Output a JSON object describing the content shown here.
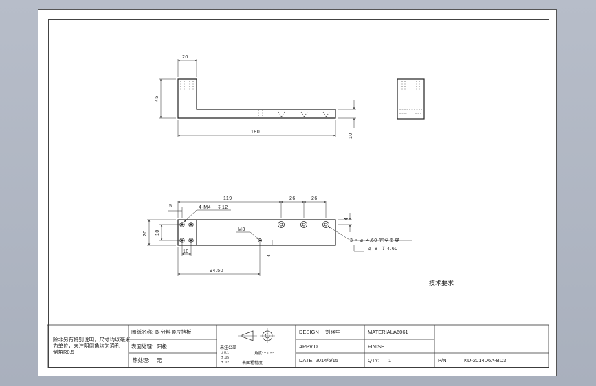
{
  "views": {
    "front": {
      "dim_width_top": "20",
      "dim_height_left": "45",
      "dim_length_bottom": "180",
      "dim_thickness_right": "10"
    },
    "top": {
      "dim_5": "5",
      "dim_119": "119",
      "dim_26a": "26",
      "dim_26b": "26",
      "dim_20": "20",
      "dim_10v": "10",
      "dim_10h": "10",
      "dim_4": "4",
      "dim_9450": "94.50",
      "callout_m4": "4-M4",
      "callout_m4_depth": "12",
      "callout_m3": "M3",
      "callout_hole_count": "3 ×",
      "callout_hole_dia": "4.60 完全贯穿",
      "callout_cbore_dia": "8",
      "callout_cbore_depth": "4.60"
    }
  },
  "tech_req_title": "技术要求",
  "title_block": {
    "note": "除非另有特别说明，尺寸均以毫米为单位，未注明倒角均为通孔倒角R0.5",
    "part_name_label": "图纸名称:",
    "part_name_value": "B-分料顶片挡板",
    "surface_label": "表面处理:",
    "surface_value": "阳极",
    "heat_label": "热处理:",
    "heat_value": "无",
    "tolerance_title": "未注公差",
    "tol_1": "± 0.1",
    "tol_2": "± .05",
    "tol_3": "± .02",
    "roughness_label": "表面粗糙度",
    "precision_label": "角度: ± 0.5°",
    "design_label": "DESIGN",
    "design_value": "刘晓中",
    "approved_label": "APPV'D",
    "date_label": "DATE: 2014/6/15",
    "material_label": "MATERIAL:",
    "material_value": "A6061",
    "finish_label": "FINISH",
    "qty_label": "QTY:",
    "qty_value": "1",
    "pn_label": "P/N",
    "pn_value": "KD-2014D6A-BD3"
  },
  "colors": {
    "background": "#b0b7c3",
    "sheet": "#ffffff",
    "lines": "#222222"
  }
}
